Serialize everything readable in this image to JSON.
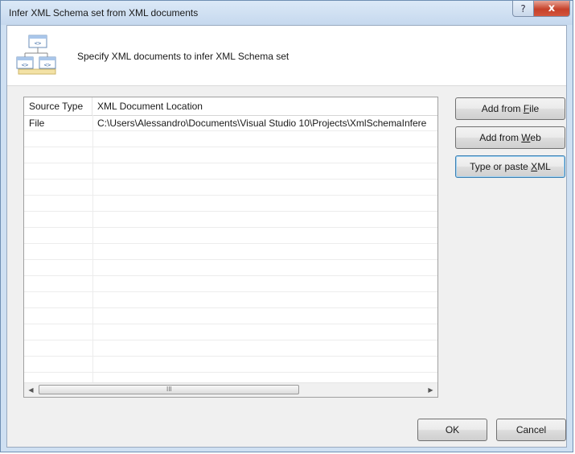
{
  "window": {
    "title": "Infer XML Schema set from XML documents",
    "help_glyph": "?",
    "close_glyph": "x"
  },
  "header": {
    "text": "Specify XML documents to infer XML Schema set",
    "icon": "xml-schema-tree-icon"
  },
  "list": {
    "columns": [
      "Source Type",
      "XML Document Location"
    ],
    "rows": [
      {
        "source_type": "File",
        "location": "C:\\Users\\Alessandro\\Documents\\Visual Studio 10\\Projects\\XmlSchemaInfere"
      }
    ],
    "scrollbar_grip": "III"
  },
  "buttons": {
    "add_from_file": {
      "pre": "Add from ",
      "mnemonic": "F",
      "post": "ile"
    },
    "add_from_web": {
      "pre": "Add from ",
      "mnemonic": "W",
      "post": "eb"
    },
    "type_or_paste": {
      "pre": "Type or paste ",
      "mnemonic": "X",
      "post": "ML"
    },
    "ok": "OK",
    "cancel": "Cancel"
  }
}
